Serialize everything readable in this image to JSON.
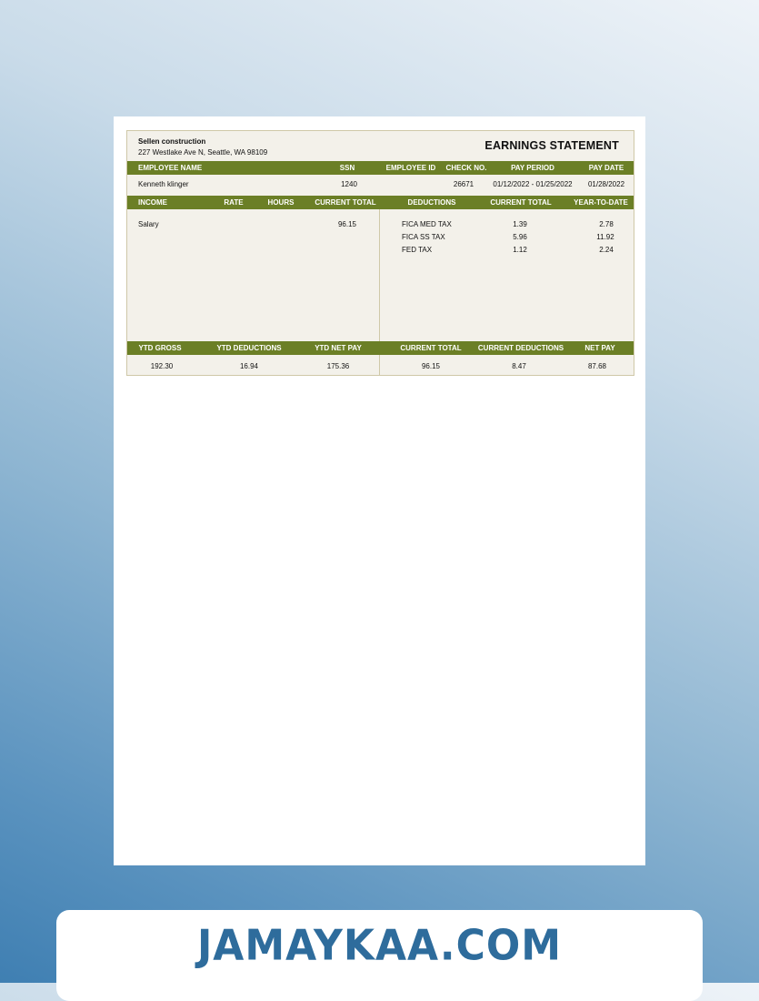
{
  "company": {
    "name": "Sellen construction",
    "address": "227 Westlake Ave N, Seattle, WA 98109"
  },
  "title": "EARNINGS STATEMENT",
  "employee_header": {
    "name": "EMPLOYEE NAME",
    "ssn": "SSN",
    "employee_id": "EMPLOYEE ID",
    "check_no": "CHECK NO.",
    "pay_period": "PAY PERIOD",
    "pay_date": "PAY DATE"
  },
  "employee": {
    "name": "Kenneth klinger",
    "ssn": "1240",
    "employee_id": "",
    "check_no": "26671",
    "pay_period": "01/12/2022 - 01/25/2022",
    "pay_date": "01/28/2022"
  },
  "income_header": {
    "income": "INCOME",
    "rate": "RATE",
    "hours": "HOURS",
    "current_total": "CURRENT TOTAL"
  },
  "deductions_header": {
    "deductions": "DEDUCTIONS",
    "current_total": "CURRENT TOTAL",
    "ytd": "YEAR-TO-DATE"
  },
  "income_rows": [
    {
      "label": "Salary",
      "rate": "",
      "hours": "",
      "current_total": "96.15"
    }
  ],
  "deduction_rows": [
    {
      "label": "FICA  MED TAX",
      "current_total": "1.39",
      "ytd": "2.78"
    },
    {
      "label": "FICA  SS TAX",
      "current_total": "5.96",
      "ytd": "11.92"
    },
    {
      "label": "FED TAX",
      "current_total": "1.12",
      "ytd": "2.24"
    }
  ],
  "summary_header": {
    "ytd_gross": "YTD GROSS",
    "ytd_deductions": "YTD DEDUCTIONS",
    "ytd_net_pay": "YTD NET PAY",
    "current_total": "CURRENT TOTAL",
    "current_deductions": "CURRENT DEDUCTIONS",
    "net_pay": "NET PAY"
  },
  "summary": {
    "ytd_gross": "192.30",
    "ytd_deductions": "16.94",
    "ytd_net_pay": "175.36",
    "current_total": "96.15",
    "current_deductions": "8.47",
    "net_pay": "87.68"
  },
  "watermark": "JAMAYKAA.COM",
  "colors": {
    "header_bar": "#6b7f26",
    "statement_bg": "#f3f1ea",
    "brand_text": "#2e6c9c"
  }
}
